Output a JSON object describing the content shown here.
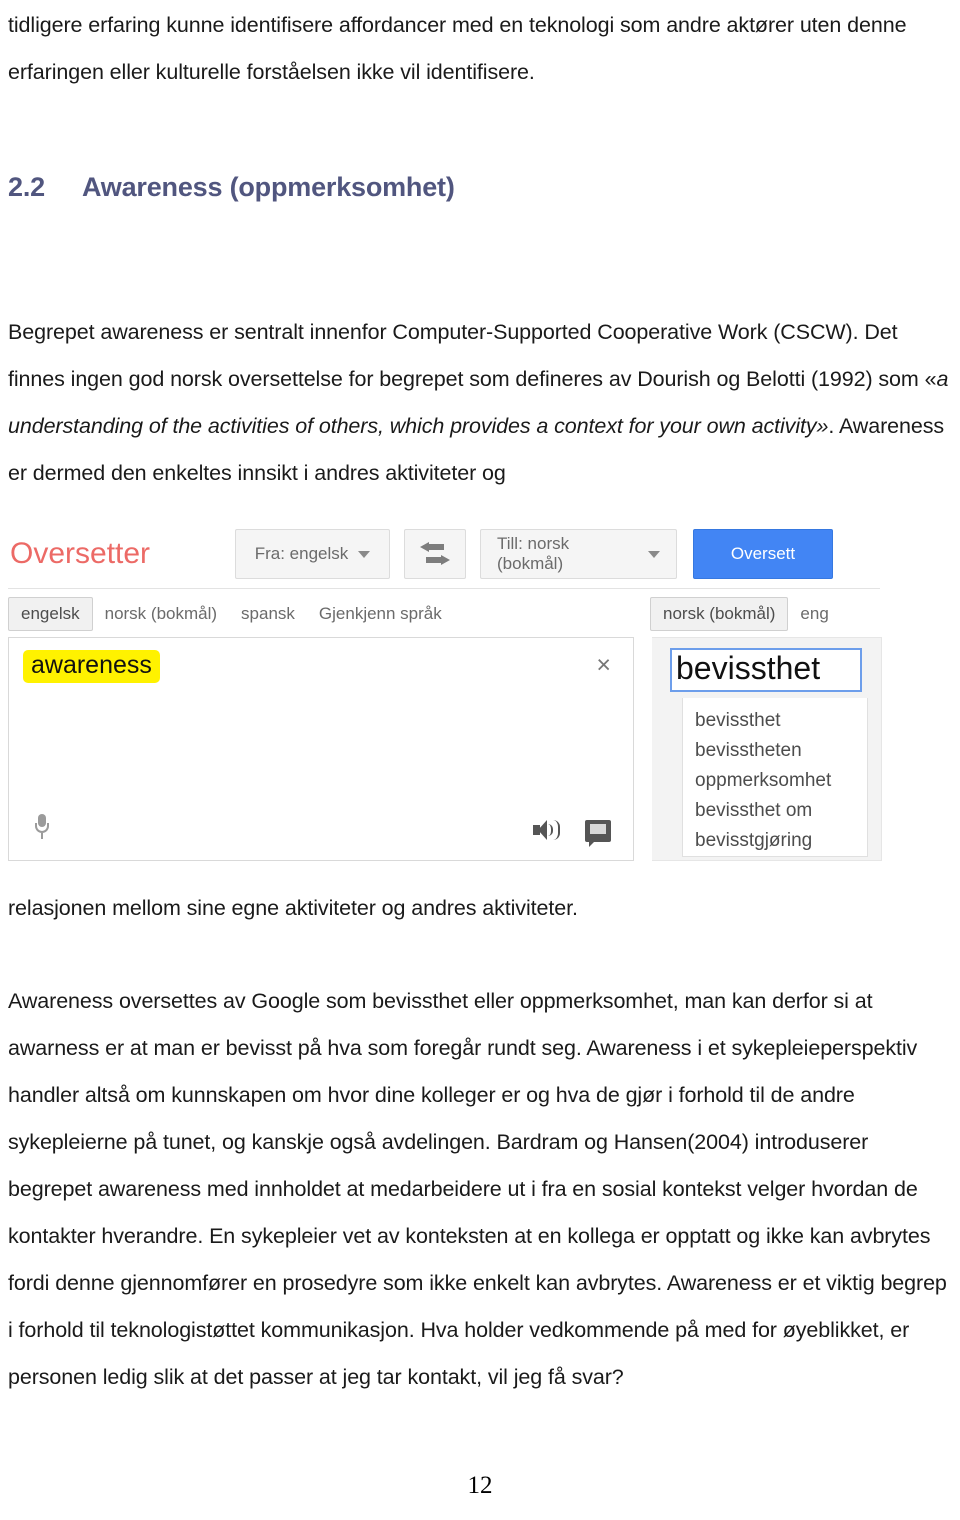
{
  "document": {
    "intro_paragraph": "tidligere erfaring kunne identifisere affordancer med en teknologi som andre aktører uten denne erfaringen eller kulturelle forståelsen ikke vil identifisere.",
    "heading": {
      "number": "2.2",
      "title": "Awareness (oppmerksomhet)",
      "color": "#51567f"
    },
    "body_para_1_a": "Begrepet awareness er sentralt innenfor Computer-Supported Cooperative Work (CSCW). Det finnes ingen god norsk oversettelse for begrepet som defineres av Dourish og Belotti (1992) som «",
    "body_para_1_italic": "a understanding of the activities of others, which provides a context for your own activity»",
    "body_para_1_b": ". Awareness er dermed den enkeltes innsikt i andres aktiviteter og",
    "body_para_after_image": "relasjonen mellom sine egne aktiviteter og andres aktiviteter.",
    "body_para_2": "Awareness oversettes av Google som bevissthet eller oppmerksomhet, man kan derfor si at awarness er at man er bevisst på hva som foregår rundt seg. Awareness i et sykepleieperspektiv handler altså om kunnskapen om hvor dine kolleger er og hva de gjør i forhold til de andre sykepleierne på tunet, og kanskje også avdelingen. Bardram og Hansen(2004) introduserer begrepet awareness med innholdet at medarbeidere ut i fra en sosial kontekst velger hvordan de kontakter hverandre. En sykepleier vet av konteksten at en kollega er opptatt og ikke kan avbrytes fordi denne gjennomfører en prosedyre som ikke enkelt kan avbrytes. Awareness er et viktig begrep i forhold til teknologistøttet kommunikasjon. Hva holder vedkommende på med for øyeblikket, er personen ledig slik at det passer at jeg tar kontakt, vil jeg få svar?",
    "page_number": "12"
  },
  "translate_screenshot": {
    "logo": "Oversetter",
    "logo_color": "#ec6a66",
    "from_button": "Fra: engelsk",
    "swap_button_label": "",
    "to_button": "Till: norsk (bokmål)",
    "translate_button": "Oversett",
    "translate_button_color": "#4285f4",
    "source_tabs": [
      {
        "label": "engelsk",
        "active": true
      },
      {
        "label": "norsk (bokmål)",
        "active": false
      },
      {
        "label": "spansk",
        "active": false
      },
      {
        "label": "Gjenkjenn språk",
        "active": false
      }
    ],
    "target_tabs": [
      {
        "label": "norsk (bokmål)",
        "active": true
      },
      {
        "label": "eng",
        "active": false
      }
    ],
    "source_text": "awareness",
    "source_highlight_color": "#fff200",
    "clear_icon": "×",
    "result_text": "bevissthet",
    "suggestions": [
      "bevissthet",
      "bevisstheten",
      "oppmerksomhet",
      "bevissthet om",
      "bevisstgjøring"
    ]
  }
}
